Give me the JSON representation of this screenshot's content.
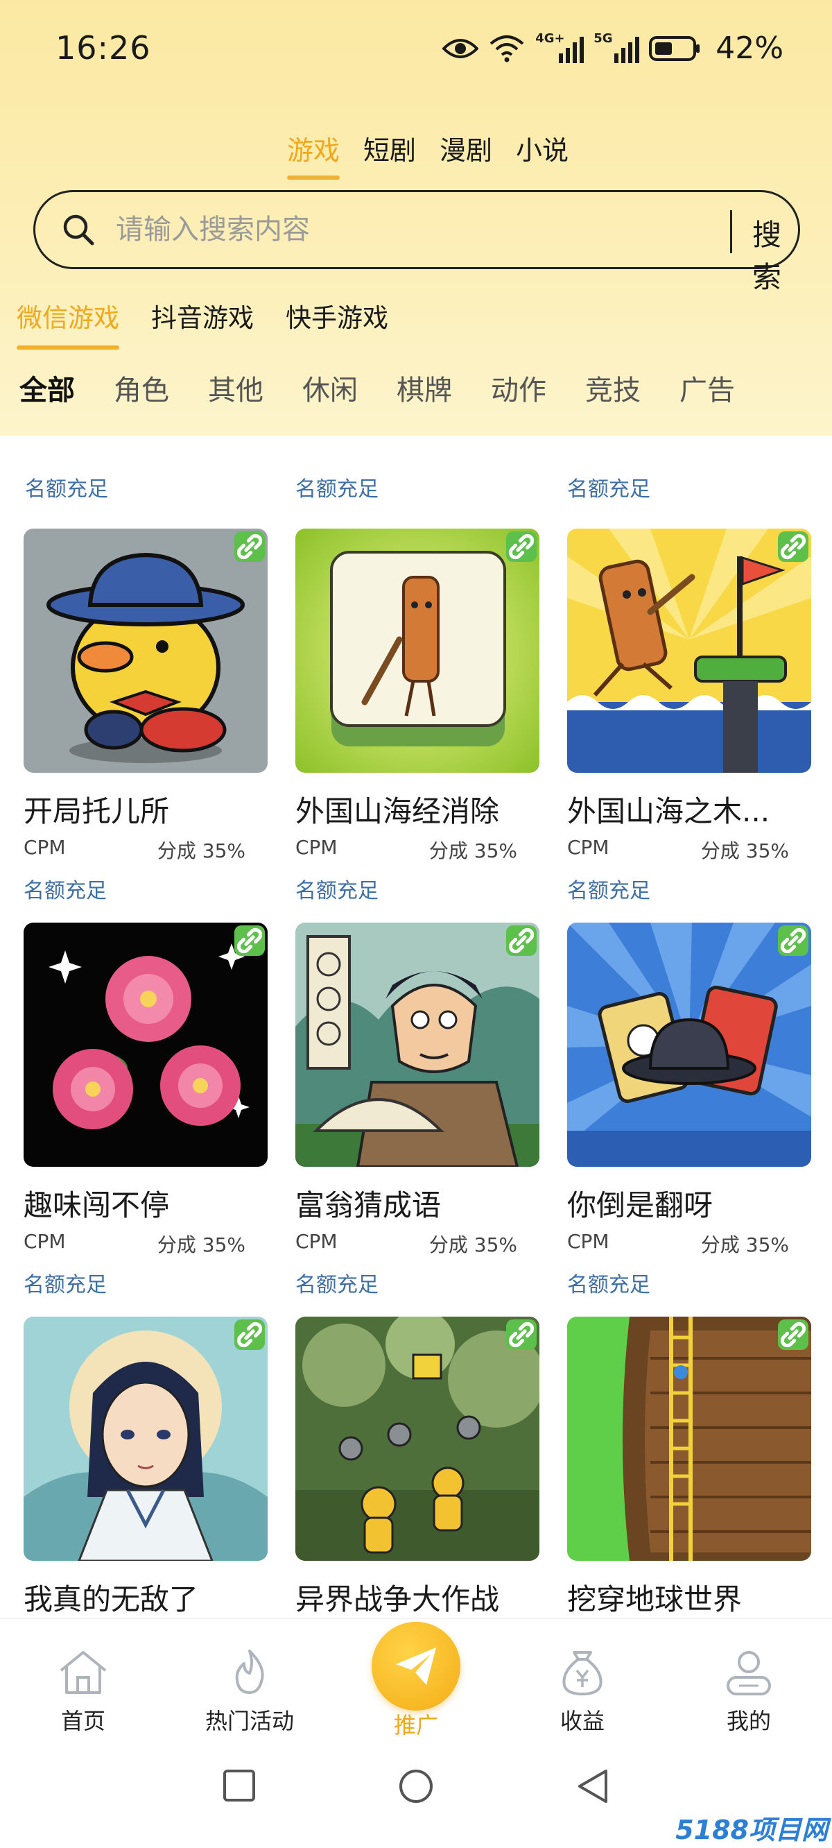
{
  "status_bar": {
    "time": "16:26",
    "battery": "42%",
    "net1": "4G+",
    "net2": "5G"
  },
  "top_tabs": [
    "游戏",
    "短剧",
    "漫剧",
    "小说"
  ],
  "search": {
    "placeholder": "请输入搜索内容",
    "button": "搜索"
  },
  "platform_tabs": [
    "微信游戏",
    "抖音游戏",
    "快手游戏"
  ],
  "genre_tabs": [
    "全部",
    "角色",
    "其他",
    "休闲",
    "棋牌",
    "动作",
    "竞技",
    "广告"
  ],
  "grid": {
    "top_notes": [
      "名额充足",
      "名额充足",
      "名额充足"
    ],
    "cards": [
      {
        "title": "开局托儿所",
        "type": "CPM",
        "share": "分成 35%",
        "note": "名额充足",
        "icon": "duck-hat-art"
      },
      {
        "title": "外国山海经消除",
        "type": "CPM",
        "share": "分成 35%",
        "note": "名额充足",
        "icon": "wood-tile-art"
      },
      {
        "title": "外国山海之木...",
        "type": "CPM",
        "share": "分成 35%",
        "note": "名额充足",
        "icon": "wood-runner-flag-art"
      },
      {
        "title": "趣味闯不停",
        "type": "CPM",
        "share": "分成 35%",
        "note": "名额充足",
        "icon": "pink-roses-art"
      },
      {
        "title": "富翁猜成语",
        "type": "CPM",
        "share": "分成 35%",
        "note": "名额充足",
        "icon": "fortune-teller-art"
      },
      {
        "title": "你倒是翻呀",
        "type": "CPM",
        "share": "分成 35%",
        "note": "名额充足",
        "icon": "cards-hat-art"
      },
      {
        "title": "我真的无敌了",
        "icon": "swordsman-art"
      },
      {
        "title": "异界战争大作战",
        "icon": "hazmat-battle-art"
      },
      {
        "title": "挖穿地球世界",
        "icon": "dig-ladder-art"
      }
    ]
  },
  "bottom_nav": [
    {
      "label": "首页",
      "icon": "home-icon"
    },
    {
      "label": "热门活动",
      "icon": "flame-icon"
    },
    {
      "label": "推广",
      "icon": "paper-plane-icon"
    },
    {
      "label": "收益",
      "icon": "money-bag-icon"
    },
    {
      "label": "我的",
      "icon": "user-icon"
    }
  ],
  "watermark": "5188项目网",
  "colors": {
    "accent": "#f0a81c",
    "header_bg": "#fbe9a3",
    "note_blue": "#3d6fa8",
    "badge_green": "#5cc04a"
  }
}
